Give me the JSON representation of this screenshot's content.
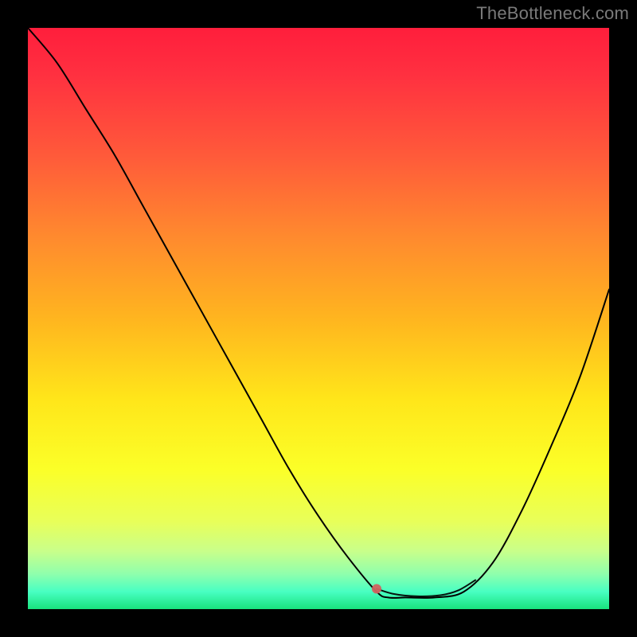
{
  "attribution": "TheBottleneck.com",
  "colors": {
    "gradient_top": "#ff1e3c",
    "gradient_mid": "#ffe61a",
    "gradient_bottom": "#18e27d",
    "curve_stroke": "#000000",
    "marker_stroke": "#d1635f",
    "background": "#000000"
  },
  "chart_data": {
    "type": "line",
    "title": "",
    "xlabel": "",
    "ylabel": "",
    "xlim": [
      0,
      100
    ],
    "ylim": [
      0,
      100
    ],
    "grid": false,
    "legend": false,
    "series": [
      {
        "name": "bottleneck-curve",
        "x": [
          0,
          5,
          10,
          15,
          20,
          25,
          30,
          35,
          40,
          45,
          50,
          55,
          60,
          62,
          65,
          70,
          75,
          80,
          85,
          90,
          95,
          100
        ],
        "y": [
          100,
          94,
          86,
          78,
          69,
          60,
          51,
          42,
          33,
          24,
          16,
          9,
          3,
          2,
          2,
          2,
          3,
          8,
          17,
          28,
          40,
          55
        ]
      }
    ],
    "highlight": {
      "name": "valley-marker",
      "x": [
        60,
        63,
        67,
        71,
        74,
        77
      ],
      "y": [
        3.5,
        2.6,
        2.2,
        2.4,
        3.2,
        5.0
      ]
    }
  }
}
